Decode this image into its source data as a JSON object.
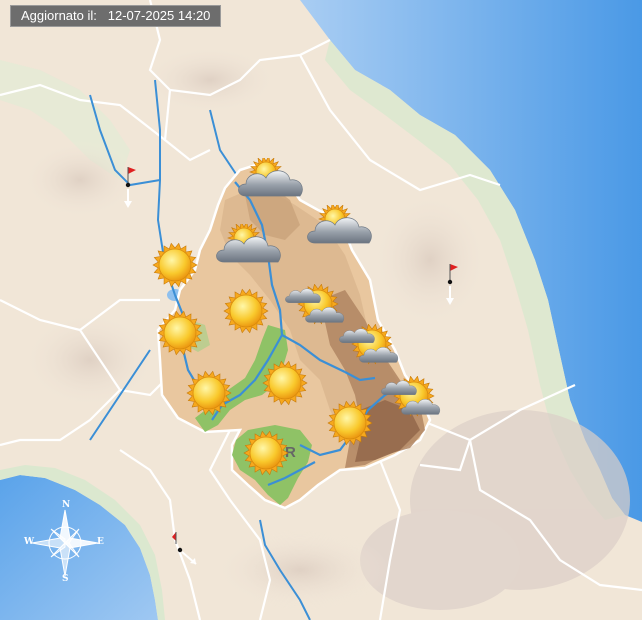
{
  "header": {
    "updated_label": "Aggiornato il:",
    "updated_value": "12-07-2025 14:20"
  },
  "compass": {
    "north": "N",
    "south": "S",
    "east": "E",
    "west": "W"
  },
  "region": {
    "city_label": "R"
  },
  "forecast": [
    {
      "kind": "sun",
      "name": "sun-icon"
    },
    {
      "kind": "sun",
      "name": "sun-icon"
    },
    {
      "kind": "sun",
      "name": "sun-icon"
    },
    {
      "kind": "sun",
      "name": "sun-icon"
    },
    {
      "kind": "sun",
      "name": "sun-icon"
    },
    {
      "kind": "sun",
      "name": "sun-icon"
    },
    {
      "kind": "sun",
      "name": "sun-icon"
    },
    {
      "kind": "cloudy",
      "name": "cloudy-icon"
    },
    {
      "kind": "cloudy",
      "name": "cloudy-icon"
    },
    {
      "kind": "cloudy",
      "name": "cloudy-icon"
    },
    {
      "kind": "partly-cloudy",
      "name": "partly-cloudy-icon"
    },
    {
      "kind": "partly-cloudy",
      "name": "partly-cloudy-icon"
    },
    {
      "kind": "partly-cloudy",
      "name": "partly-cloudy-icon"
    }
  ],
  "wind": [
    {
      "direction": "south",
      "name": "wind-marker-north"
    },
    {
      "direction": "south",
      "name": "wind-marker-east"
    },
    {
      "direction": "south-east",
      "name": "wind-marker-south"
    }
  ],
  "colors": {
    "sea": "#4a9be8",
    "land": "#f2e6d6",
    "region_low": "#e9c79f",
    "region_mid": "#c6a07a",
    "region_high": "#9c7458",
    "plain": "#8fc266",
    "river": "#3b8fd6",
    "border": "#ffffff"
  }
}
